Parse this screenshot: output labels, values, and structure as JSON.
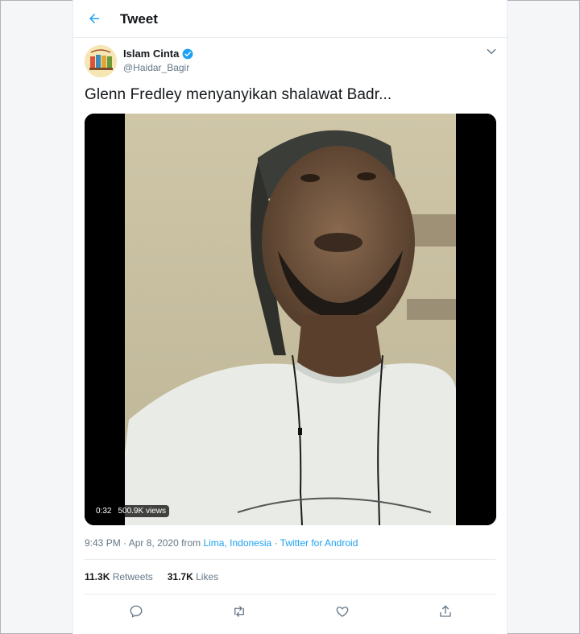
{
  "header": {
    "title": "Tweet",
    "back_icon": "arrow-left-icon",
    "accent": "#1da1f2"
  },
  "author": {
    "display_name": "Islam Cinta",
    "handle": "@Haidar_Bagir",
    "verified": true,
    "verified_icon": "verified-badge-icon",
    "more_icon": "chevron-down-icon"
  },
  "tweet": {
    "text": "Glenn Fredley menyanyikan shalawat Badr..."
  },
  "media": {
    "duration": "0:32",
    "views": "500.9K views"
  },
  "meta": {
    "time": "9:43 PM",
    "date": "Apr 8, 2020",
    "from_label": "from",
    "location": "Lima, Indonesia",
    "source": "Twitter for Android",
    "separator": "·"
  },
  "stats": {
    "retweets_count": "11.3K",
    "retweets_label": "Retweets",
    "likes_count": "31.7K",
    "likes_label": "Likes"
  },
  "actions": [
    "reply-icon",
    "retweet-icon",
    "like-icon",
    "share-icon"
  ]
}
